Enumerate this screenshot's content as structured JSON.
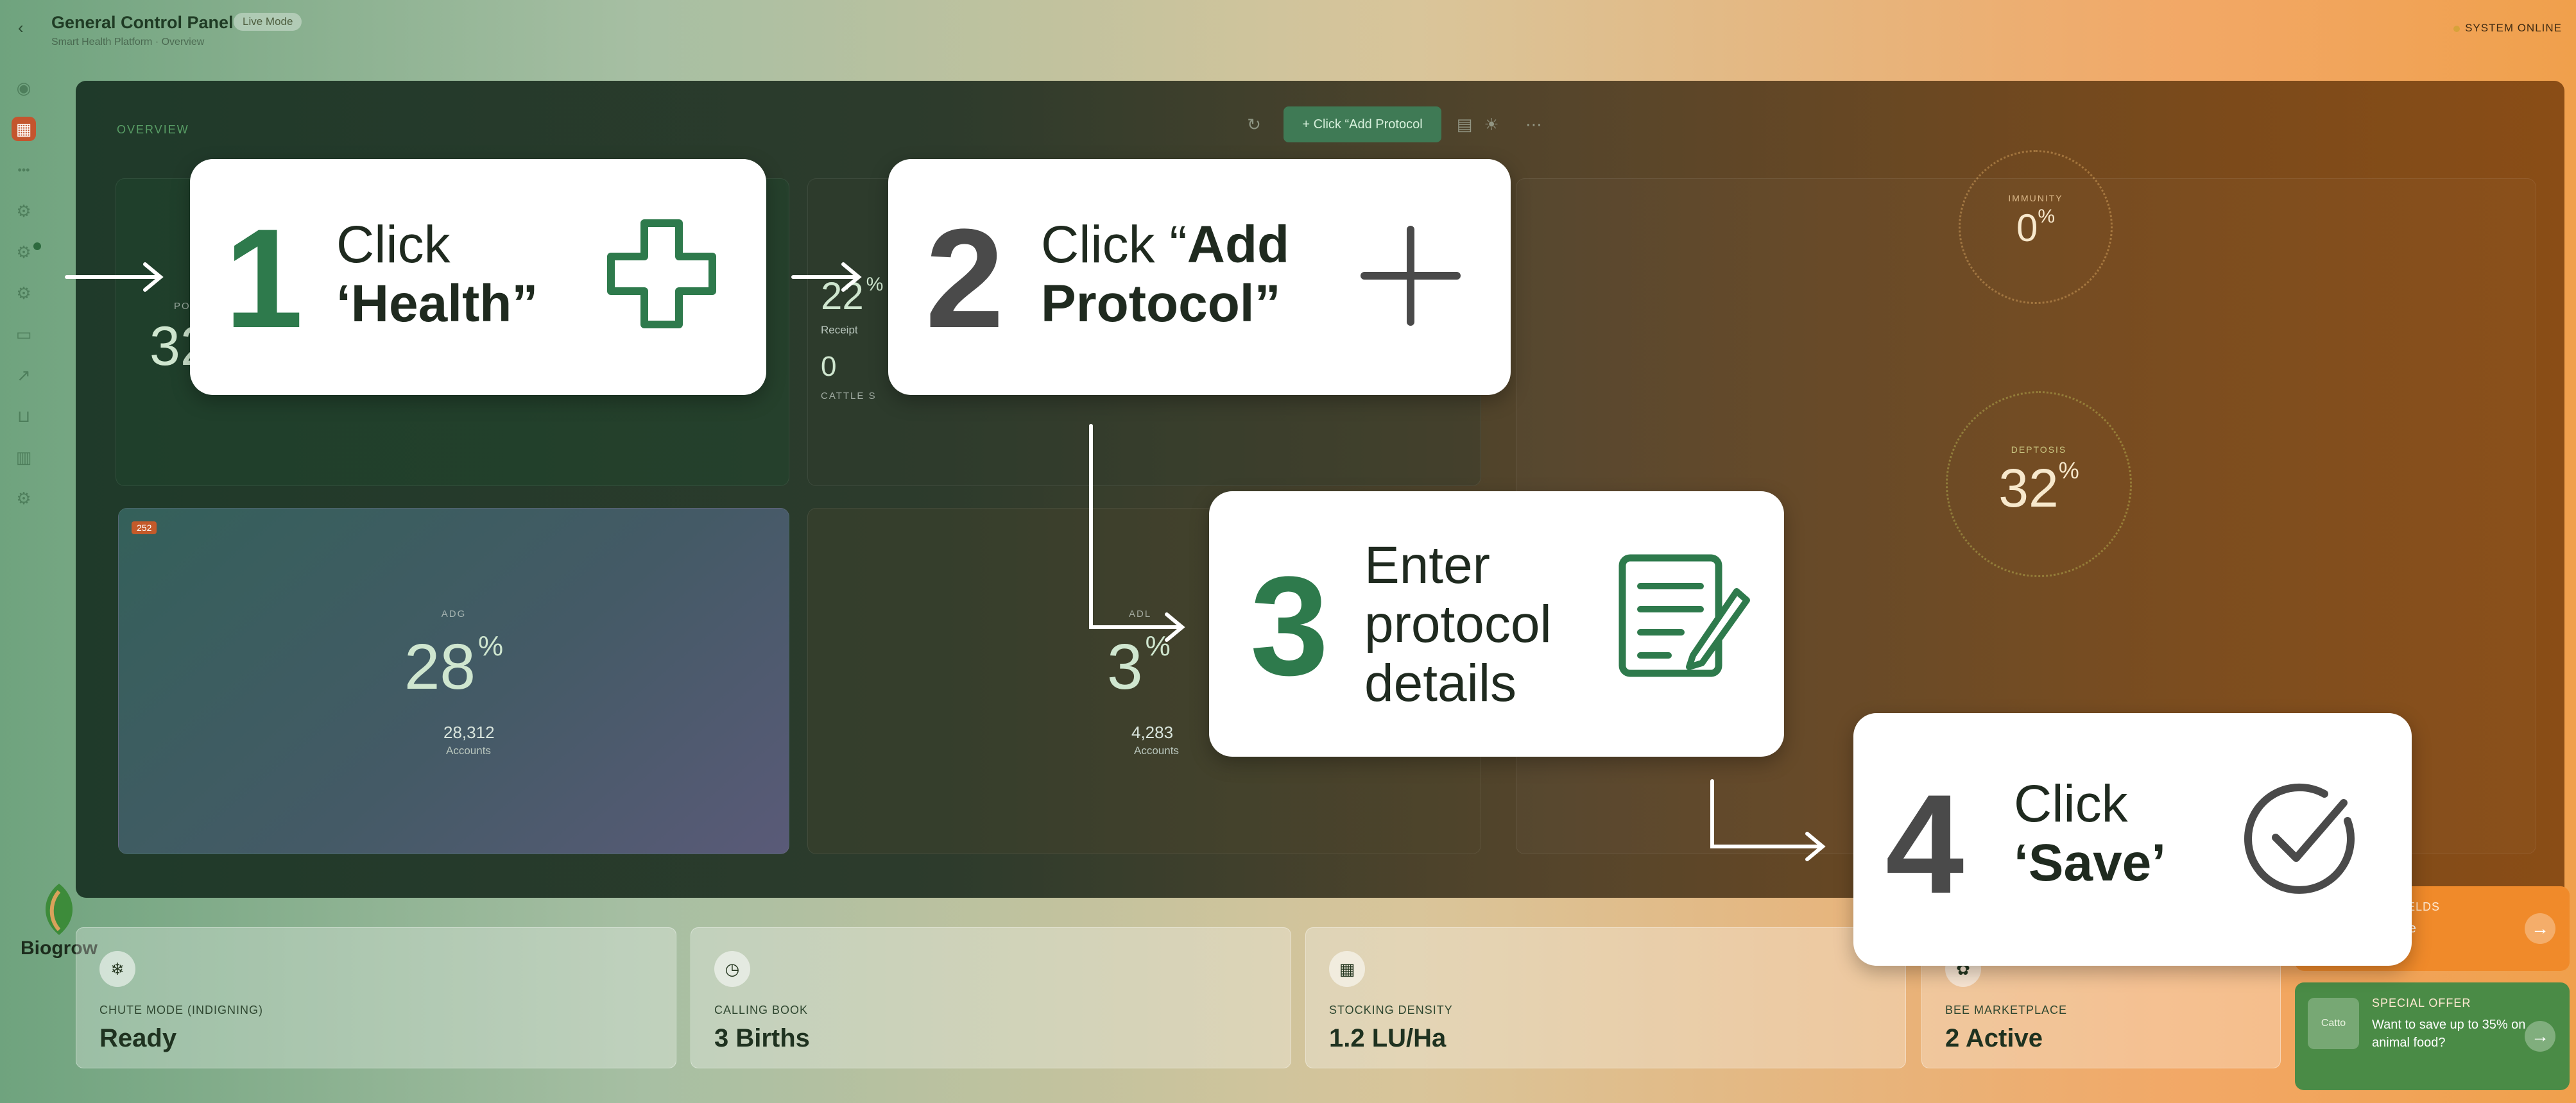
{
  "header": {
    "title": "General Control Panel",
    "badge": "Live Mode",
    "subtitle": "Smart Health Platform · Overview",
    "status": "SYSTEM ONLINE"
  },
  "panel": {
    "label": "OVERVIEW",
    "add_button": "+ Click “Add Protocol",
    "cards": {
      "top_left": {
        "caption": "POS",
        "value": "32"
      },
      "top_mid": {
        "value": "22",
        "unit": "%",
        "sub": "Receipt",
        "value2": "0",
        "caption2": "CATTLE S"
      },
      "bottom_left": {
        "tag": "252",
        "caption": "ADG",
        "value": "28",
        "unit": "%",
        "count": "28,312",
        "count_label": "Accounts"
      },
      "bottom_mid": {
        "caption": "ADL",
        "value": "3",
        "unit": "%",
        "count": "4,283",
        "count_label": "Accounts"
      }
    },
    "gauges": [
      {
        "caption": "IMMUNITY",
        "value": "0",
        "unit": "%"
      },
      {
        "caption": "DEPTOSIS",
        "value": "32",
        "unit": "%"
      }
    ]
  },
  "bottom_cards": [
    {
      "caption": "CHUTE MODE (INDIGNING)",
      "value": "Ready",
      "icon": "snowflake-icon"
    },
    {
      "caption": "CALLING BOOK",
      "value": "3 Births",
      "icon": "clock-icon"
    },
    {
      "caption": "STOCKING DENSITY",
      "value": "1.2 LU/Ha",
      "icon": "chart-icon"
    },
    {
      "caption": "BEE MARKETPLACE",
      "value": "2 Active",
      "icon": "bee-icon"
    }
  ],
  "promos": {
    "orange": {
      "caption": "UM VIELDS",
      "text": "as a ice"
    },
    "green": {
      "caption": "SPECIAL OFFER",
      "text": "Want to save up to 35% on animal food?",
      "image": "Catto"
    }
  },
  "logo": {
    "text": "Biogrow"
  },
  "callouts": [
    {
      "num": "1",
      "line1": "Click",
      "line2": "‘Health”",
      "icon": "plus-cross-icon"
    },
    {
      "num": "2",
      "line1a": "Click “",
      "line1b": "Add",
      "line2": "Protocol”",
      "icon": "plus-icon"
    },
    {
      "num": "3",
      "line1": "Enter",
      "line2": "protocol",
      "line3": "details",
      "icon": "document-edit-icon"
    },
    {
      "num": "4",
      "line1": "Click",
      "line2": "‘Save’",
      "icon": "check-circle-icon"
    }
  ],
  "colors": {
    "accent_green": "#2e7a4c",
    "accent_orange": "#f08a2a",
    "panel_dark": "#1f3a2a"
  }
}
